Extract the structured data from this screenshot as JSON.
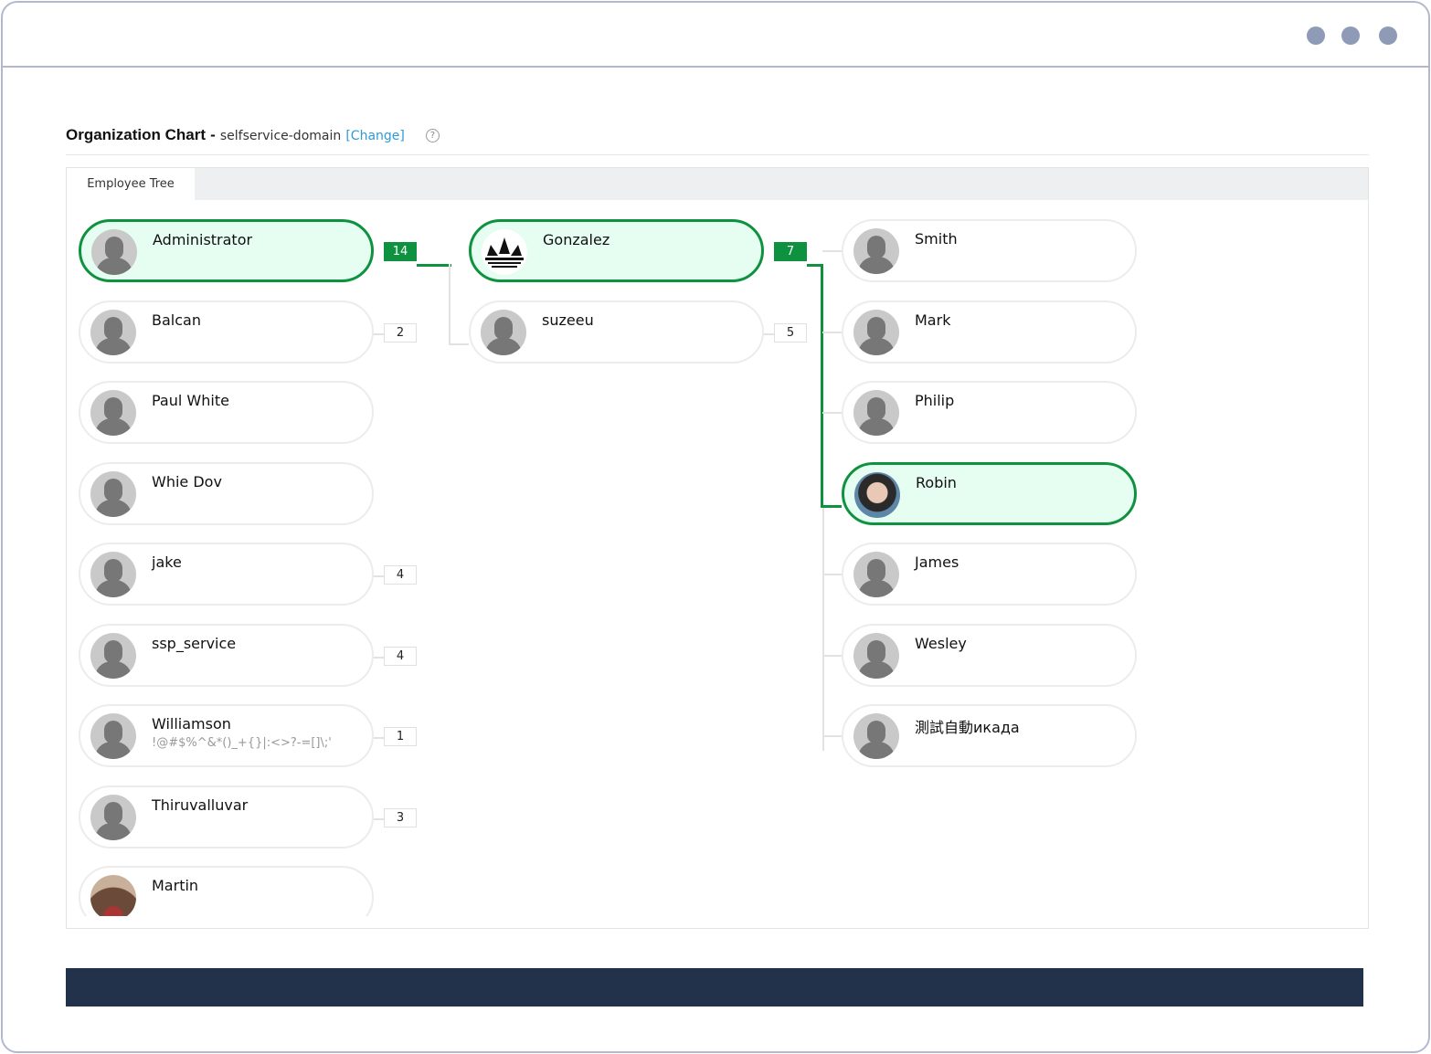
{
  "window": {
    "controls": [
      "dot",
      "dot",
      "dot"
    ]
  },
  "header": {
    "title": "Organization Chart",
    "separator": "-",
    "domain": "selfservice-domain",
    "change_link": "[Change]",
    "help_icon": "?"
  },
  "tabs": [
    {
      "label": "Employee Tree",
      "active": true
    }
  ],
  "accent_color": "#0f923f",
  "tree": {
    "columns": [
      [
        {
          "name": "Administrator",
          "count": "14",
          "selected": true,
          "avatar": "default"
        },
        {
          "name": "Balcan",
          "count": "2",
          "avatar": "default"
        },
        {
          "name": "Paul White",
          "avatar": "default"
        },
        {
          "name": "Whie Dov",
          "avatar": "default"
        },
        {
          "name": "jake",
          "count": "4",
          "avatar": "default"
        },
        {
          "name": "ssp_service",
          "count": "4",
          "avatar": "default"
        },
        {
          "name": "Williamson",
          "subtitle": "!@#$%^&*()_+{}|:<>?-=[]\\;'",
          "count": "1",
          "avatar": "default"
        },
        {
          "name": "Thiruvalluvar",
          "count": "3",
          "avatar": "default"
        },
        {
          "name": "Martin",
          "avatar": "photo2"
        }
      ],
      [
        {
          "name": "Gonzalez",
          "count": "7",
          "selected": true,
          "avatar": "logo"
        },
        {
          "name": "suzeeu",
          "count": "5",
          "avatar": "default"
        }
      ],
      [
        {
          "name": "Smith",
          "avatar": "default"
        },
        {
          "name": "Mark",
          "avatar": "default"
        },
        {
          "name": "Philip",
          "avatar": "default"
        },
        {
          "name": "Robin",
          "selected": true,
          "avatar": "photo"
        },
        {
          "name": "James",
          "avatar": "default"
        },
        {
          "name": "Wesley",
          "avatar": "default"
        },
        {
          "name": "測試自動икада",
          "avatar": "default"
        }
      ]
    ]
  }
}
